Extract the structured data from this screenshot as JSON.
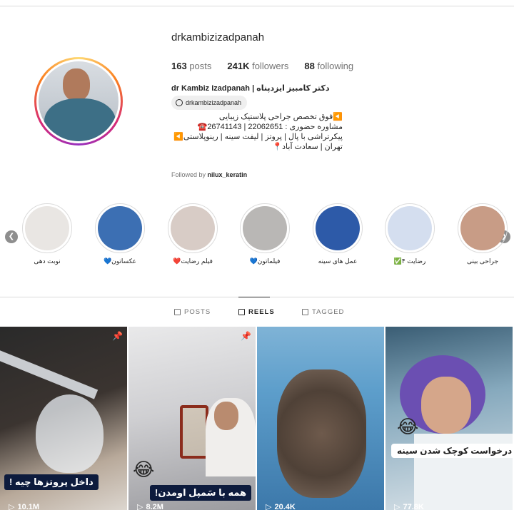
{
  "profile": {
    "username": "drkambizizadpanah",
    "posts_count": "163",
    "posts_label": "posts",
    "followers_count": "241K",
    "followers_label": "followers",
    "following_count": "88",
    "following_label": "following",
    "full_name": "dr Kambiz Izadpanah | دکتر کامبیز ایزدپناه",
    "threads_handle": "drkambizizadpanah",
    "bio_lines": [
      "◀️فوق تخصص جراحی پلاستیک زیبایی",
      "مشاوره حضوری : 22062651 | 26741143☎️",
      "پیکرتراشی با پال | پروتز | لیفت سینه | رینوپلاستی◀️",
      "تهران | سعادت آباد📍"
    ],
    "followed_by_prefix": "Followed by",
    "followed_by_user": "nilux_keratin"
  },
  "highlights": [
    {
      "label": "نوبت دهی",
      "color": "#e9e6e3",
      "icon": "clinic-logo-icon"
    },
    {
      "label": "عکساتون💙",
      "color": "#3c6fb3",
      "icon": "photo-grid-icon"
    },
    {
      "label": "فیلم رضایت❤️",
      "color": "#d8ccc6",
      "icon": "video-icon"
    },
    {
      "label": "فیلماتون💙",
      "color": "#b9b7b5",
      "icon": "video-icon"
    },
    {
      "label": "عمل های سینه",
      "color": "#2d5aa8",
      "icon": "doctor-photo-icon"
    },
    {
      "label": "رضایت ۴✅",
      "color": "#d4deef",
      "icon": "review-icon"
    },
    {
      "label": "جراحی بینی",
      "color": "#c89c86",
      "icon": "face-photo-icon"
    }
  ],
  "tabs": [
    {
      "label": "POSTS",
      "icon": "grid-icon",
      "active": false
    },
    {
      "label": "REELS",
      "icon": "reels-icon",
      "active": true
    },
    {
      "label": "TAGGED",
      "icon": "tag-icon",
      "active": false
    }
  ],
  "reels": [
    {
      "views": "10.1M",
      "caption": "داخل پروتزها چیه !",
      "pinned": true
    },
    {
      "views": "8.2M",
      "caption": "همه با سَمپل اومدن!",
      "pinned": true
    },
    {
      "views": "20.4K",
      "caption": "",
      "pinned": false
    },
    {
      "views": "77.8K",
      "caption": "درخواست کوچک شدن سینه",
      "pinned": false
    }
  ],
  "colors": {
    "accent": "#262626",
    "muted": "#737373",
    "divider": "#dbdbdb"
  }
}
